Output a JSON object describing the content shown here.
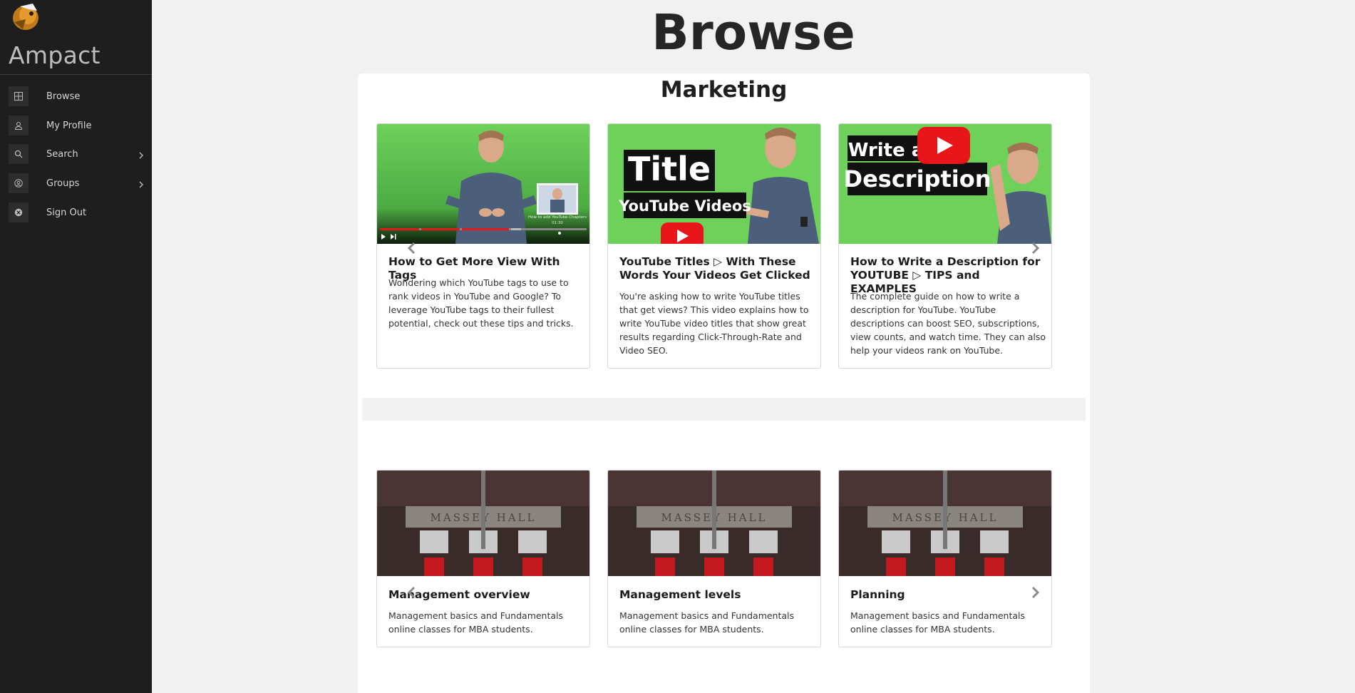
{
  "app": {
    "name": "Ampact"
  },
  "sidebar": {
    "items": [
      {
        "label": "Browse",
        "icon": "grid-icon"
      },
      {
        "label": "My Profile",
        "icon": "user-icon"
      },
      {
        "label": "Search",
        "icon": "search-icon",
        "chevron": true
      },
      {
        "label": "Groups",
        "icon": "group-icon",
        "chevron": true
      },
      {
        "label": "Sign Out",
        "icon": "close-circle-icon"
      }
    ]
  },
  "page": {
    "title": "Browse"
  },
  "sections": [
    {
      "title": "Marketing",
      "cards": [
        {
          "title": "How to Get More View With Tags",
          "description": "Wondering which YouTube tags to use to rank videos in YouTube and Google? To leverage YouTube tags to their fullest potential, check out these tips and tricks.",
          "thumb_overlay": "How to add YouTube Chapters",
          "thumb_time": "01:30"
        },
        {
          "title": "YouTube Titles ▷ With These Words Your Videos Get Clicked",
          "description": "You're asking how to write YouTube titles that get views? This video explains how to write YouTube video titles that show great results regarding Click-Through-Rate and Video SEO.",
          "thumb_line1": "Title",
          "thumb_line2": "YouTube Videos"
        },
        {
          "title": "How to Write a Description for YOUTUBE ▷ TIPS and EXAMPLES",
          "description": "The complete guide on how to write a description for YouTube. YouTube descriptions can boost SEO, subscriptions, view counts, and watch time. They can also help your videos rank on YouTube.",
          "thumb_line1": "Write a",
          "thumb_line2": "Description"
        }
      ]
    },
    {
      "title": "",
      "cards": [
        {
          "title": "Management overview",
          "description": "Management basics and Fundamentals online classes for MBA students.",
          "thumb_sign": "MASSEY HALL"
        },
        {
          "title": "Management levels",
          "description": "Management basics and Fundamentals online classes for MBA students.",
          "thumb_sign": "MASSEY HALL"
        },
        {
          "title": "Planning",
          "description": "Management basics and Fundamentals online classes for MBA students.",
          "thumb_sign": "MASSEY HALL"
        }
      ]
    }
  ],
  "colors": {
    "sidebar_bg": "#1e1e1e",
    "page_bg": "#f1f1f1",
    "thumb_green": "#6dd15a",
    "youtube_red": "#e8151b"
  }
}
